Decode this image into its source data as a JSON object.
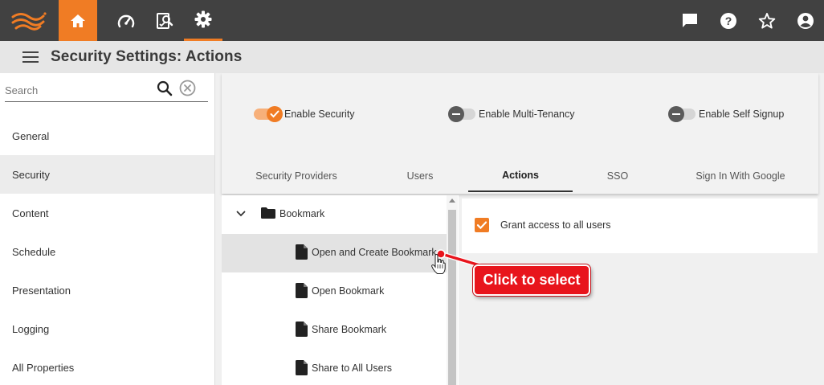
{
  "topbar": {
    "logo": "swirl-logo",
    "nav": [
      {
        "name": "home",
        "icon": "home-icon",
        "active": true
      },
      {
        "name": "dashboard",
        "icon": "speedometer-icon"
      },
      {
        "name": "reports",
        "icon": "report-search-icon"
      },
      {
        "name": "settings",
        "icon": "gear-icon",
        "selected": true
      }
    ],
    "right_icons": [
      "chat-icon",
      "help-icon",
      "star-icon",
      "account-icon"
    ],
    "accent_color": "#f07c24"
  },
  "titlebar": {
    "title": "Security Settings: Actions"
  },
  "sidebar": {
    "search_placeholder": "Search",
    "items": [
      {
        "label": "General"
      },
      {
        "label": "Security",
        "active": true
      },
      {
        "label": "Content"
      },
      {
        "label": "Schedule"
      },
      {
        "label": "Presentation"
      },
      {
        "label": "Logging"
      },
      {
        "label": "All Properties"
      }
    ]
  },
  "toggles": [
    {
      "label": "Enable Security",
      "on": true
    },
    {
      "label": "Enable Multi-Tenancy",
      "on": false
    },
    {
      "label": "Enable Self Signup",
      "on": false
    }
  ],
  "tabs": [
    {
      "label": "Security Providers"
    },
    {
      "label": "Users"
    },
    {
      "label": "Actions",
      "active": true
    },
    {
      "label": "SSO"
    },
    {
      "label": "Sign In With Google"
    }
  ],
  "tree": {
    "folder": "Bookmark",
    "items": [
      {
        "label": "Open and Create Bookmark",
        "selected": true
      },
      {
        "label": "Open Bookmark"
      },
      {
        "label": "Share Bookmark"
      },
      {
        "label": "Share to All Users"
      }
    ]
  },
  "permissions": {
    "grant_all_label": "Grant access to all users",
    "grant_all_checked": true
  },
  "annotation": {
    "text": "Click to select",
    "color": "#e8141c"
  }
}
